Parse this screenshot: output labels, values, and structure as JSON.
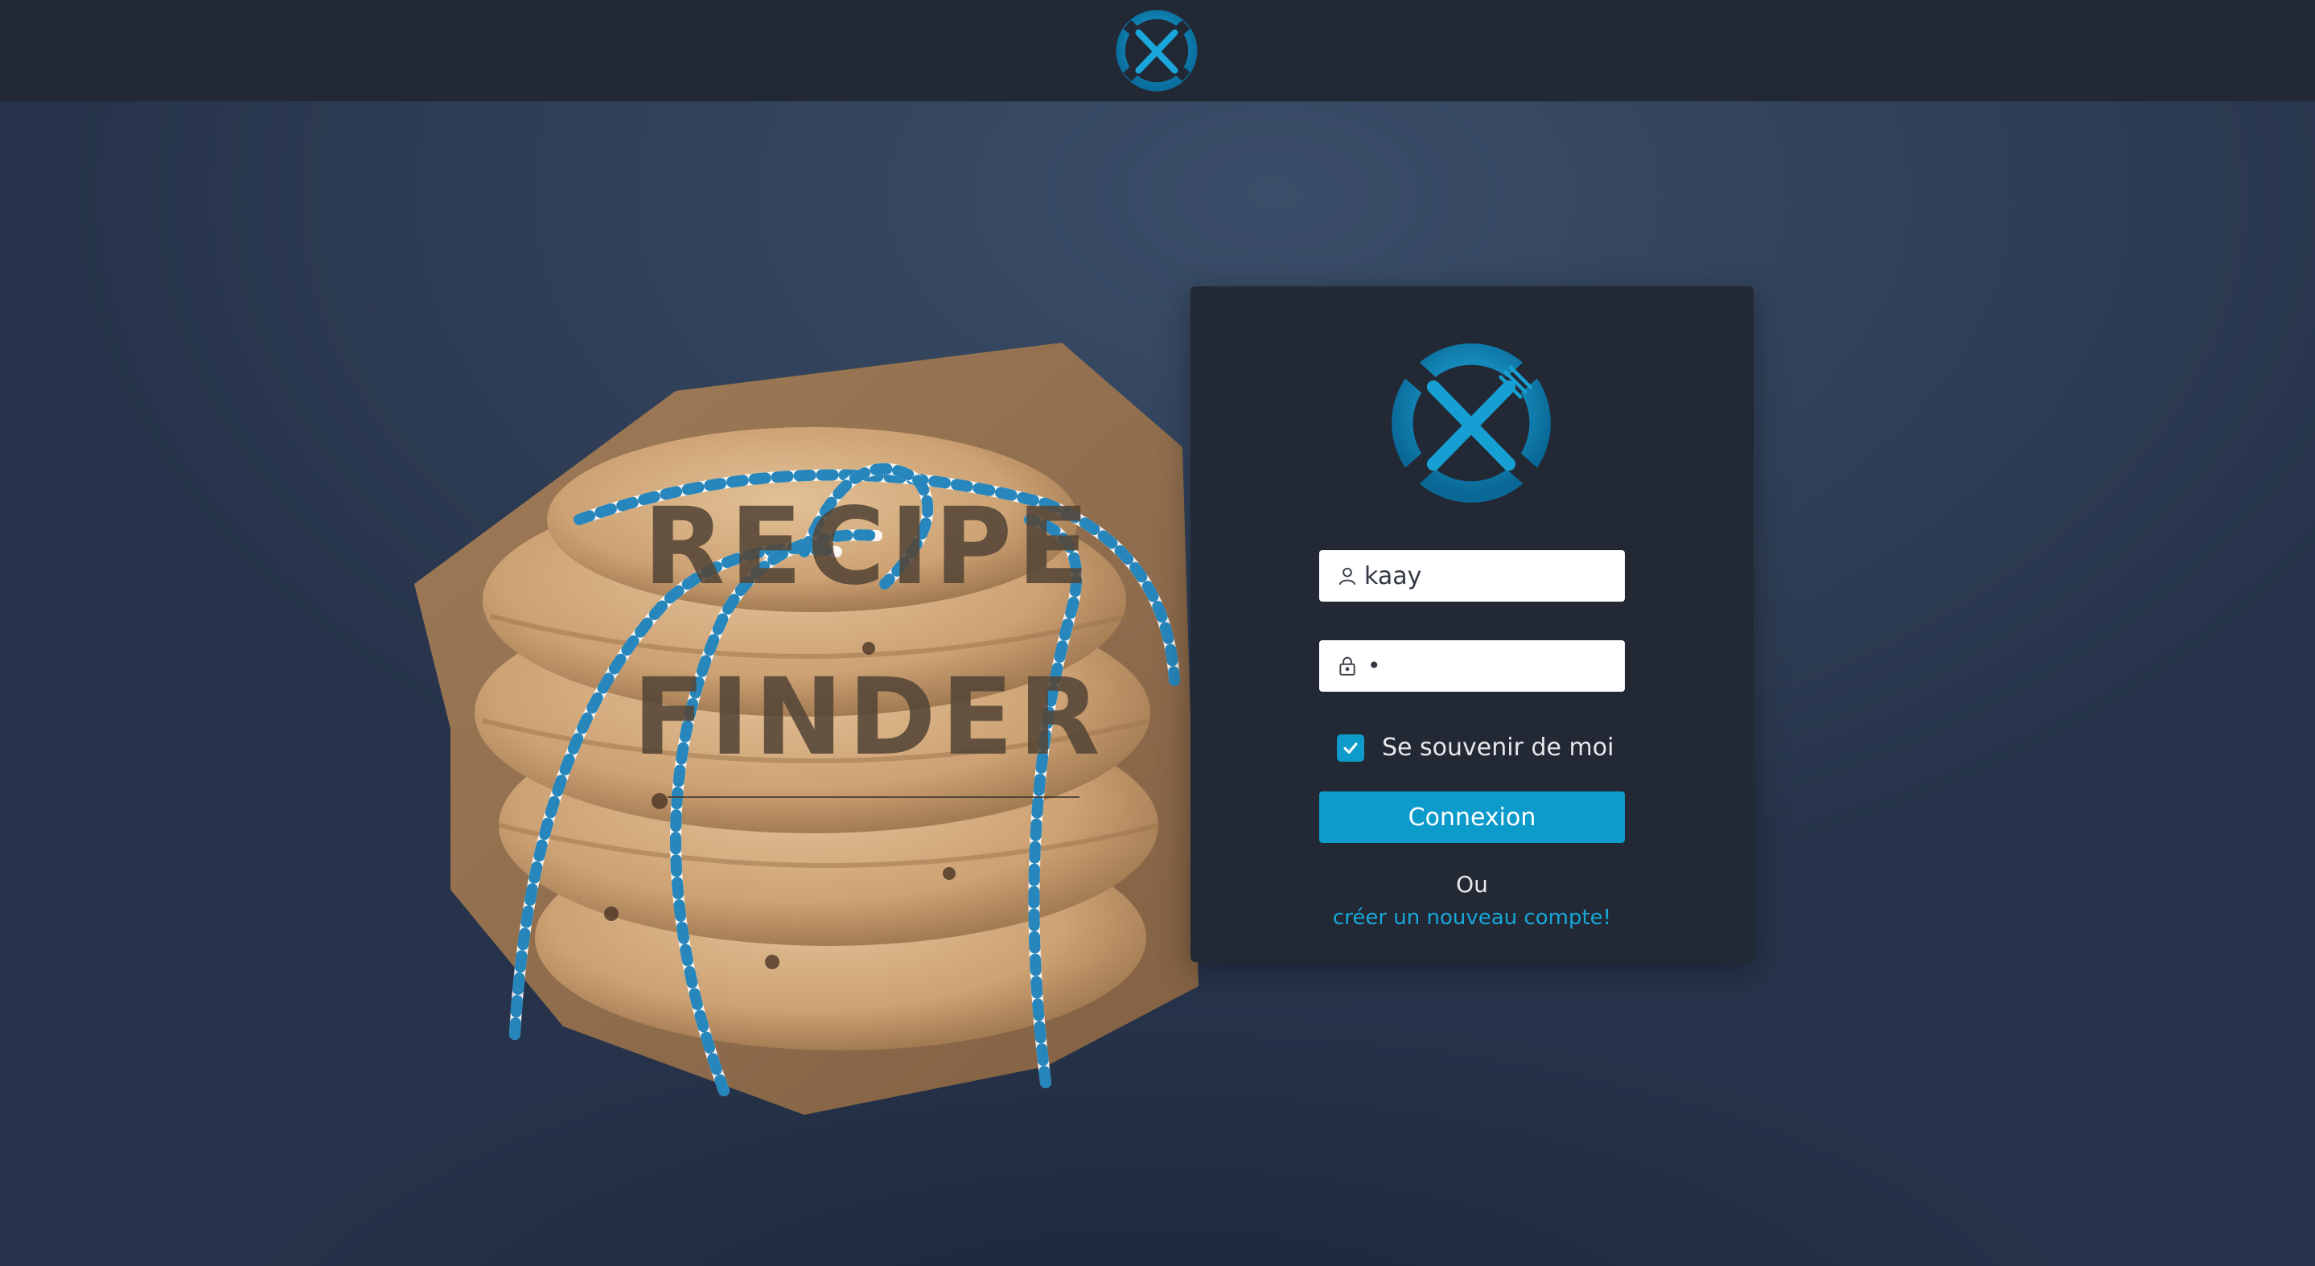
{
  "header": {
    "logo_icon": "fork-knife-crossed-logo-icon"
  },
  "hero": {
    "title_line1": "RECIPE",
    "title_line2": "FINDER",
    "background_image": "stack-of-cookies-tied-with-blue-white-string"
  },
  "login": {
    "logo_icon": "fork-knife-crossed-logo-icon",
    "username": {
      "value": "kaay",
      "icon": "user-icon"
    },
    "password": {
      "masked_value": "•",
      "icon": "lock-icon"
    },
    "remember": {
      "label": "Se souvenir de moi",
      "checked": true
    },
    "submit_label": "Connexion",
    "or_text": "Ou",
    "create_account_link": "créer un nouveau compte!"
  },
  "colors": {
    "accent": "#0d9bcb",
    "header_bg": "#222834",
    "card_bg": "#222834",
    "page_bg": "#2f3e55",
    "link": "#17a8da"
  }
}
